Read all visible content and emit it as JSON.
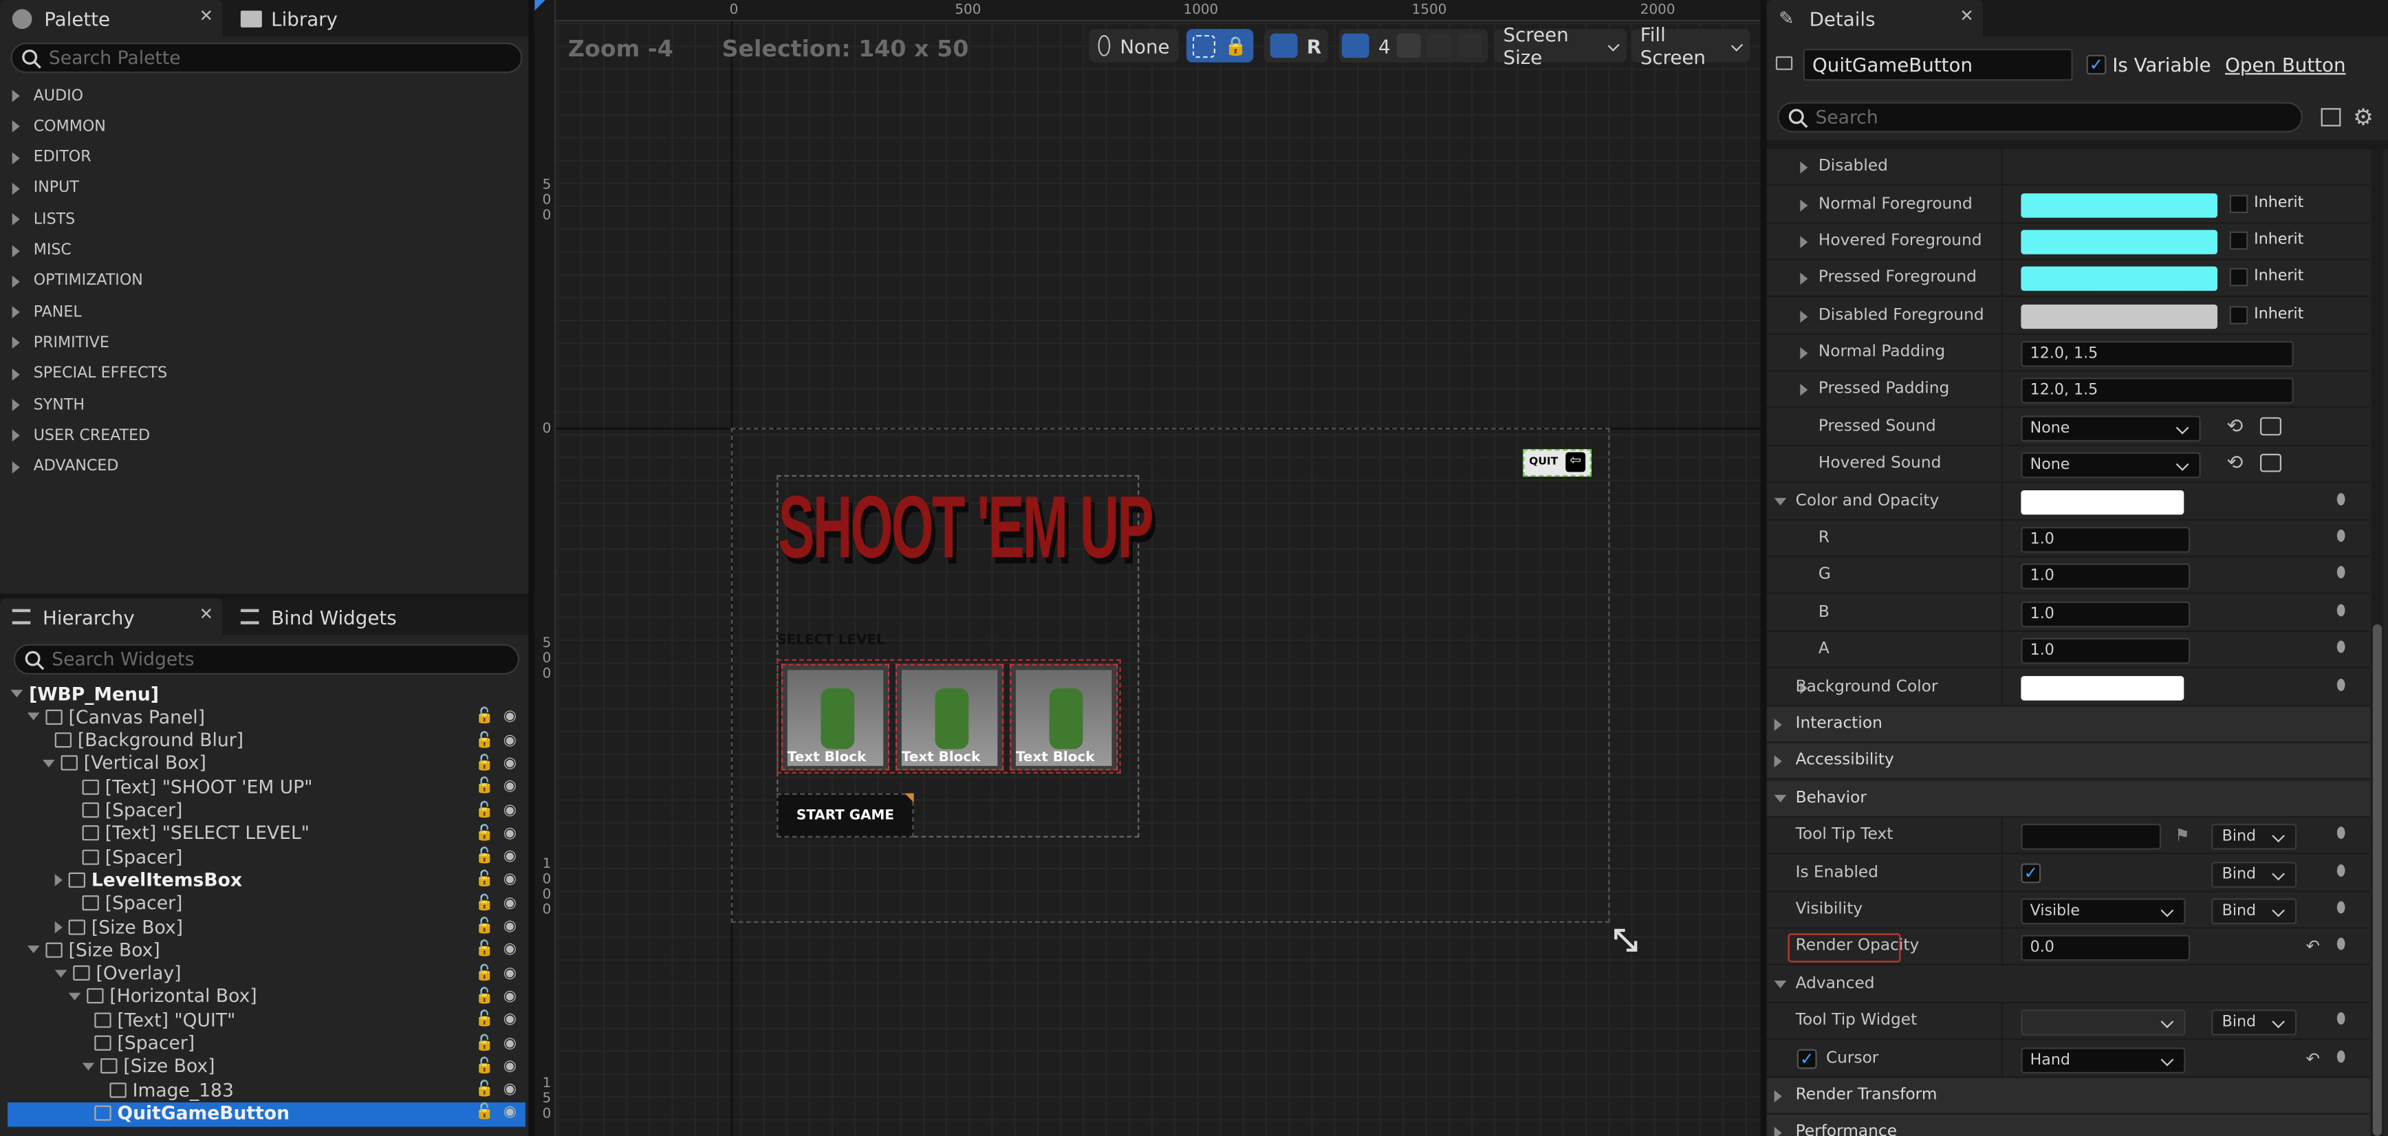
{
  "palette": {
    "tab_label": "Palette",
    "library_tab_label": "Library",
    "search_placeholder": "Search Palette",
    "categories": [
      "AUDIO",
      "COMMON",
      "EDITOR",
      "INPUT",
      "LISTS",
      "MISC",
      "OPTIMIZATION",
      "PANEL",
      "PRIMITIVE",
      "SPECIAL EFFECTS",
      "SYNTH",
      "USER CREATED",
      "ADVANCED"
    ]
  },
  "hierarchy": {
    "tab_label": "Hierarchy",
    "bind_tab_label": "Bind Widgets",
    "search_placeholder": "Search Widgets",
    "items": [
      {
        "label": "[WBP_Menu]"
      },
      {
        "label": "[Canvas Panel]"
      },
      {
        "label": "[Background Blur]"
      },
      {
        "label": "[Vertical Box]"
      },
      {
        "label": "[Text] \"SHOOT 'EM UP\""
      },
      {
        "label": "[Spacer]"
      },
      {
        "label": "[Text] \"SELECT LEVEL\""
      },
      {
        "label": "[Spacer]"
      },
      {
        "label": "LevelItemsBox"
      },
      {
        "label": "[Spacer]"
      },
      {
        "label": "[Size Box]"
      },
      {
        "label": "[Size Box]"
      },
      {
        "label": "[Overlay]"
      },
      {
        "label": "[Horizontal Box]"
      },
      {
        "label": "[Text] \"QUIT\""
      },
      {
        "label": "[Spacer]"
      },
      {
        "label": "[Size Box]"
      },
      {
        "label": "Image_183"
      },
      {
        "label": "QuitGameButton"
      }
    ]
  },
  "viewport": {
    "zoom": "Zoom -4",
    "selection": "Selection: 140 x 50",
    "ruler_top": [
      "0",
      "500",
      "1000",
      "1500",
      "2000"
    ],
    "ruler_left": [
      "5\n0\n0",
      "0",
      "5\n0\n0",
      "1\n0\n0\n0",
      "1\n5\n0"
    ],
    "toolbar": {
      "none_label": "None",
      "r_label": "R",
      "grid_value": "4",
      "screen_size": "Screen Size",
      "fill_screen": "Fill Screen"
    },
    "canvas": {
      "title": "SHOOT 'EM UP",
      "select_level": "SELECT LEVEL",
      "level_labels": [
        "Text Block",
        "Text Block",
        "Text Block"
      ],
      "start_button": "START GAME",
      "quit_label": "QUIT"
    }
  },
  "details": {
    "tab_label": "Details",
    "name_value": "QuitGameButton",
    "is_variable_label": "Is Variable",
    "open_button_label": "Open Button",
    "search_placeholder": "Search",
    "rows": {
      "disabled": "Disabled",
      "normal_fg": "Normal Foreground",
      "hovered_fg": "Hovered Foreground",
      "pressed_fg": "Pressed Foreground",
      "disabled_fg": "Disabled Foreground",
      "inherit": "Inherit",
      "normal_padding": "Normal Padding",
      "normal_padding_value": "12.0, 1.5",
      "pressed_padding": "Pressed Padding",
      "pressed_padding_value": "12.0, 1.5",
      "pressed_sound": "Pressed Sound",
      "pressed_sound_value": "None",
      "hovered_sound": "Hovered Sound",
      "hovered_sound_value": "None",
      "color_opacity": "Color and Opacity",
      "r": "R",
      "r_value": "1.0",
      "g": "G",
      "g_value": "1.0",
      "b": "B",
      "b_value": "1.0",
      "a": "A",
      "a_value": "1.0",
      "background_color": "Background Color",
      "interaction": "Interaction",
      "accessibility": "Accessibility",
      "behavior": "Behavior",
      "tooltip_text": "Tool Tip Text",
      "bind": "Bind",
      "is_enabled": "Is Enabled",
      "visibility": "Visibility",
      "visibility_value": "Visible",
      "render_opacity": "Render Opacity",
      "render_opacity_value": "0.0",
      "advanced": "Advanced",
      "tooltip_widget": "Tool Tip Widget",
      "cursor": "Cursor",
      "cursor_value": "Hand",
      "render_transform": "Render Transform",
      "performance": "Performance"
    },
    "colors": {
      "foreground": "#66f5f7",
      "disabled_fg": "#c8c8c8",
      "white": "#ffffff",
      "highlight": "#c8372d"
    }
  }
}
